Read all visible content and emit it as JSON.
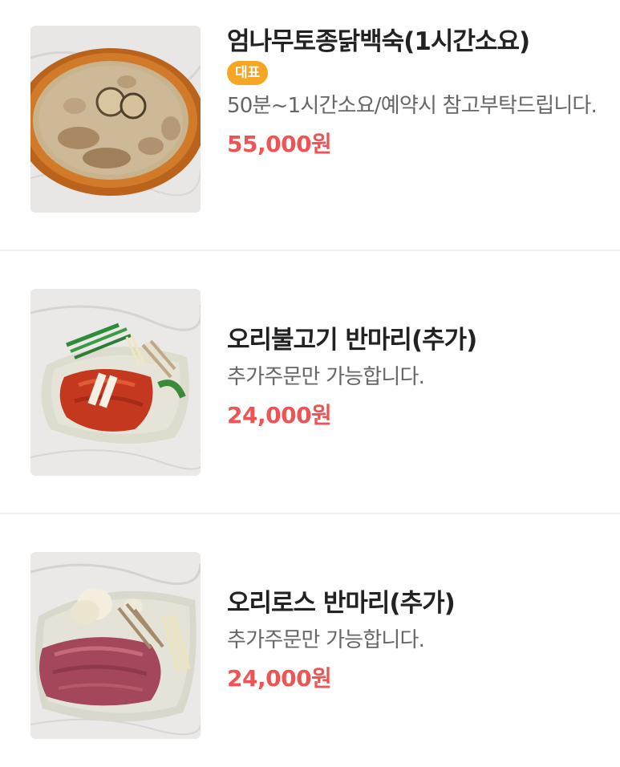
{
  "menu": {
    "items": [
      {
        "name": "엄나무토종닭백숙(1시간소요)",
        "badge": "대표",
        "description": "50분~1시간소요/예약시 참고부탁드립니다.",
        "price": "55,000원",
        "image_icon": "chicken-soup-photo"
      },
      {
        "name": "오리불고기 반마리(추가)",
        "description": "추가주문만 가능합니다.",
        "price": "24,000원",
        "image_icon": "duck-bulgogi-photo"
      },
      {
        "name": "오리로스 반마리(추가)",
        "description": "추가주문만 가능합니다.",
        "price": "24,000원",
        "image_icon": "duck-roast-photo"
      }
    ]
  },
  "colors": {
    "badge_bg": "#f6a623",
    "price": "#f05353",
    "divider": "#ececec"
  }
}
